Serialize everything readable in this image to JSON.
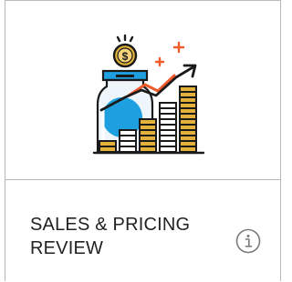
{
  "card": {
    "title": "SALES & PRICING REVIEW",
    "image_icon": "sales-growth-illustration-icon",
    "info_icon": "info-icon"
  },
  "colors": {
    "outline": "#1a1a1a",
    "coin_gold": "#e2b23a",
    "accent_orange": "#ef5a2a",
    "accent_blue": "#1ea0e0",
    "jar_fill": "#eef5fb",
    "border": "#b8b8b8",
    "info_gray": "#7a7a7a"
  }
}
